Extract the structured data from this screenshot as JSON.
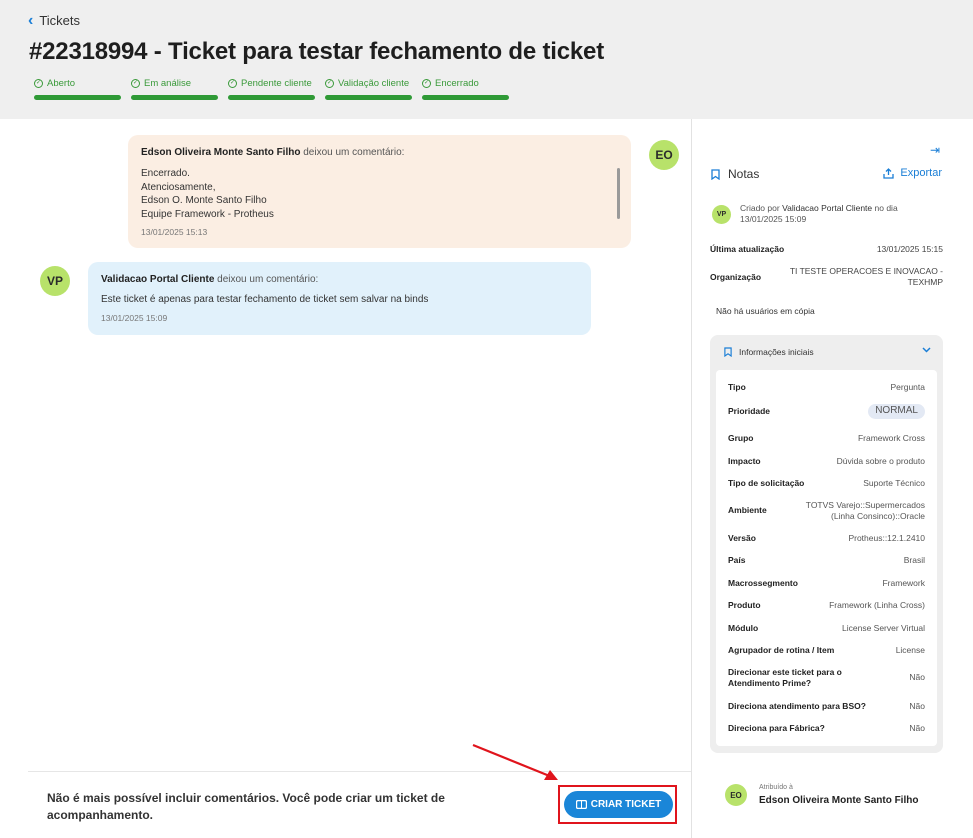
{
  "header": {
    "back_label": "Tickets",
    "title": "#22318994 - Ticket para testar fechamento de ticket",
    "steps": [
      {
        "label": "Aberto"
      },
      {
        "label": "Em análise"
      },
      {
        "label": "Pendente cliente"
      },
      {
        "label": "Validação cliente"
      },
      {
        "label": "Encerrado"
      }
    ]
  },
  "comments": [
    {
      "author": "Edson Oliveira Monte Santo Filho",
      "action": " deixou um comentário:",
      "body": "Encerrado.\nAtenciosamente,\nEdson O. Monte Santo Filho\nEquipe Framework - Protheus",
      "time": "13/01/2025 15:13",
      "initials": "EO"
    },
    {
      "author": "Validacao Portal Cliente",
      "action": " deixou um comentário:",
      "body": "Este ticket é apenas para testar fechamento de ticket sem salvar na binds",
      "time": "13/01/2025 15:09",
      "initials": "VP"
    }
  ],
  "footer": {
    "message": "Não é mais possível incluir comentários. Você pode criar um ticket de acompanhamento.",
    "button_label": "CRIAR TICKET"
  },
  "sidebar": {
    "notas_label": "Notas",
    "exportar_label": "Exportar",
    "created": {
      "initials": "VP",
      "prefix": "Criado por ",
      "author": "Validacao Portal Cliente",
      "suffix": " no dia",
      "date": "13/01/2025 15:09"
    },
    "ultima_label": "Última atualização",
    "ultima_value": "13/01/2025 15:15",
    "org_label": "Organização",
    "org_value": "TI TESTE OPERACOES E INOVACAO - TEXHMP",
    "no_copy": "Não há usuários em cópia",
    "info_title": "Informações iniciais",
    "info_rows": [
      {
        "k": "Tipo",
        "v": "Pergunta"
      },
      {
        "k": "Prioridade",
        "v": "NORMAL"
      },
      {
        "k": "Grupo",
        "v": "Framework Cross"
      },
      {
        "k": "Impacto",
        "v": "Dúvida sobre o produto"
      },
      {
        "k": "Tipo de solicitação",
        "v": "Suporte Técnico"
      },
      {
        "k": "Ambiente",
        "v": "TOTVS Varejo::Supermercados (Linha Consinco)::Oracle"
      },
      {
        "k": "Versão",
        "v": "Protheus::12.1.2410"
      },
      {
        "k": "País",
        "v": "Brasil"
      },
      {
        "k": "Macrossegmento",
        "v": "Framework"
      },
      {
        "k": "Produto",
        "v": "Framework (Linha Cross)"
      },
      {
        "k": "Módulo",
        "v": "License Server Virtual"
      },
      {
        "k": "Agrupador de rotina / Item",
        "v": "License"
      },
      {
        "k": "Direcionar este ticket para o Atendimento Prime?",
        "v": "Não"
      },
      {
        "k": "Direciona atendimento para BSO?",
        "v": "Não"
      },
      {
        "k": "Direciona para Fábrica?",
        "v": "Não"
      }
    ],
    "assigned_label": "Atribuído à",
    "assigned_initials": "EO",
    "assigned_name": "Edson Oliveira Monte Santo Filho"
  },
  "colors": {
    "accent": "#1a86d8",
    "status_green": "#2f9a36",
    "highlight_red": "#e0141c",
    "avatar": "#b8e26a"
  }
}
